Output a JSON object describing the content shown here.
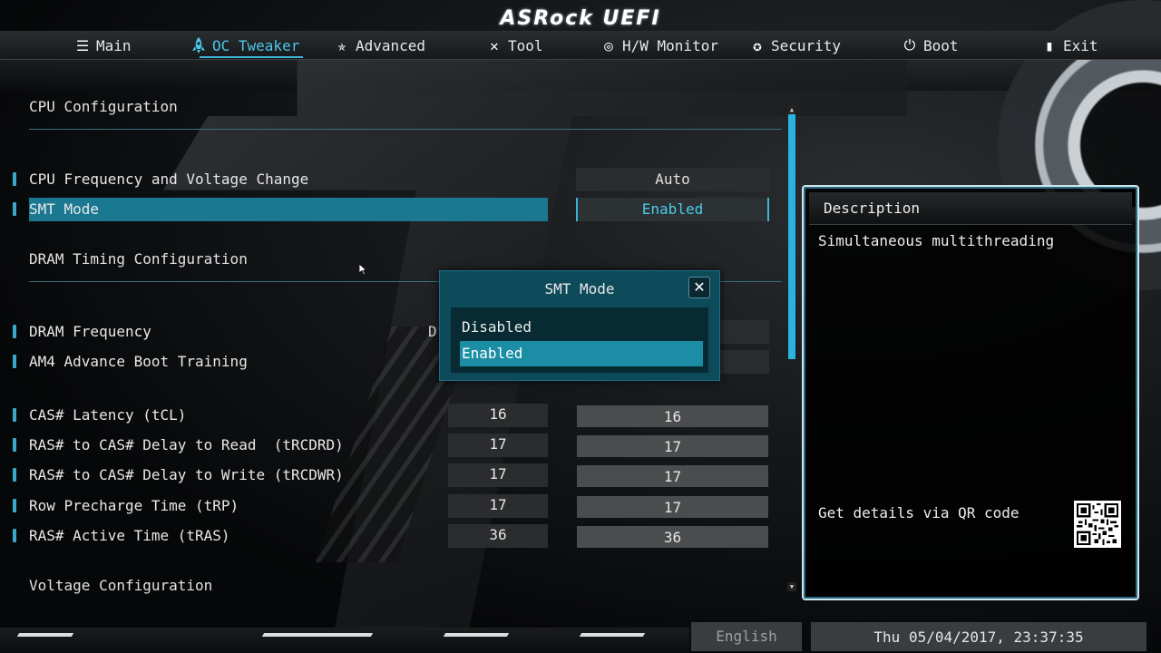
{
  "brand": "ASRock UEFI",
  "tabs": [
    {
      "label": "Main",
      "icon": "list-icon"
    },
    {
      "label": "OC Tweaker",
      "icon": "rocket-icon"
    },
    {
      "label": "Advanced",
      "icon": "star-icon"
    },
    {
      "label": "Tool",
      "icon": "tools-icon"
    },
    {
      "label": "H/W Monitor",
      "icon": "monitor-icon"
    },
    {
      "label": "Security",
      "icon": "shield-icon"
    },
    {
      "label": "Boot",
      "icon": "power-icon"
    },
    {
      "label": "Exit",
      "icon": "exit-icon"
    }
  ],
  "active_tab": "OC Tweaker",
  "sections": {
    "cpu": "CPU Configuration",
    "dram": "DRAM Timing Configuration",
    "voltage": "Voltage Configuration"
  },
  "cpu_items": [
    {
      "label": "CPU Frequency and Voltage Change",
      "value": "Auto"
    },
    {
      "label": "SMT Mode",
      "value": "Enabled"
    }
  ],
  "dram_items": [
    {
      "label": "DRAM Frequency",
      "value_prefix": "D"
    },
    {
      "label": "AM4 Advance Boot Training"
    }
  ],
  "timing_items": [
    {
      "label": "CAS# Latency (tCL)",
      "current": "16",
      "value": "16"
    },
    {
      "label": "RAS# to CAS# Delay to Read  (tRCDRD)",
      "current": "17",
      "value": "17"
    },
    {
      "label": "RAS# to CAS# Delay to Write (tRCDWR)",
      "current": "17",
      "value": "17"
    },
    {
      "label": "Row Precharge Time (tRP)",
      "current": "17",
      "value": "17"
    },
    {
      "label": "RAS# Active Time (tRAS)",
      "current": "36",
      "value": "36"
    }
  ],
  "popup": {
    "title": "SMT Mode",
    "close": "✕",
    "options": [
      "Disabled",
      "Enabled"
    ],
    "selected": "Enabled"
  },
  "description": {
    "title": "Description",
    "text": "Simultaneous multithreading",
    "qr_label": "Get details via QR code"
  },
  "footer": {
    "language": "English",
    "datetime": "Thu 05/04/2017, 23:37:35"
  },
  "colors": {
    "accent": "#3bb5d6",
    "highlight": "#1a7890",
    "popup_bg": "#0e4b5a"
  }
}
